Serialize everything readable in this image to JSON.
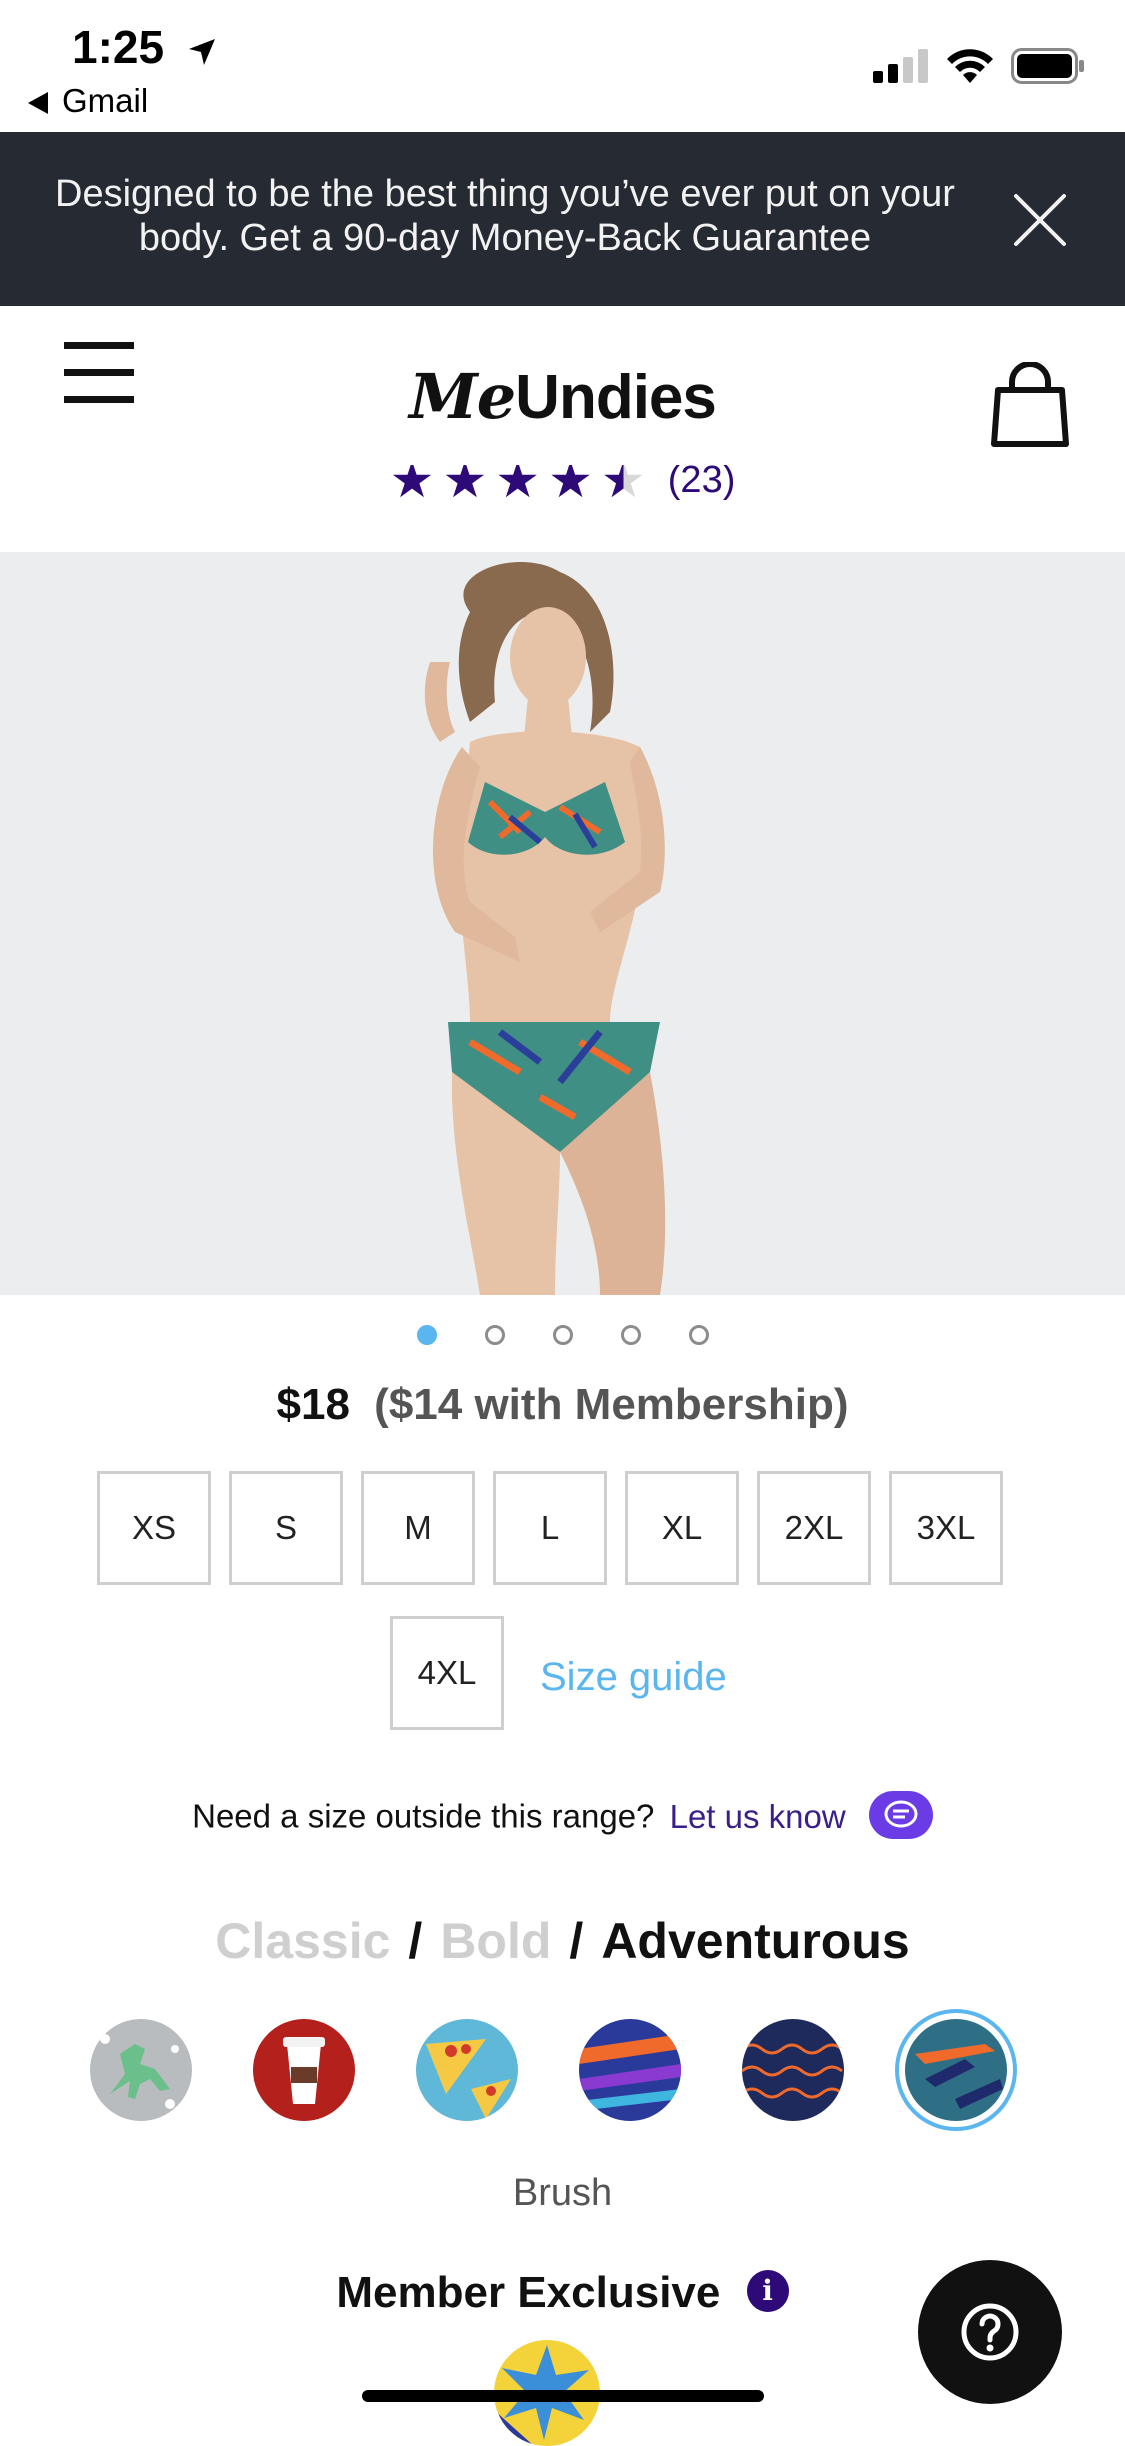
{
  "status_bar": {
    "time": "1:25",
    "back_app": "Gmail"
  },
  "promo": {
    "text": "Designed to be the best thing you’ve ever put on your body. Get a 90-day Money-Back Guarantee"
  },
  "header": {
    "logo_me": "Me",
    "logo_rest": "Undies"
  },
  "rating": {
    "stars": 4.5,
    "count": "(23)",
    "color": "#2d0a78"
  },
  "carousel": {
    "total": 5,
    "active_index": 0,
    "active_color": "#5bb6f0"
  },
  "price": {
    "price": "$18",
    "member_price": "($14 with Membership)"
  },
  "sizes": [
    "XS",
    "S",
    "M",
    "L",
    "XL",
    "2XL",
    "3XL",
    "4XL"
  ],
  "size_guide": "Size guide",
  "need_size": {
    "text": "Need a size outside this range?",
    "link": "Let us know"
  },
  "category": {
    "classic": "Classic",
    "sep1": "/",
    "bold": "Bold",
    "sep2": "/",
    "adventurous": "Adventurous"
  },
  "swatches": [
    {
      "icon": "dinosaur-pattern-icon"
    },
    {
      "icon": "coffee-cup-pattern-icon"
    },
    {
      "icon": "pizza-pattern-icon"
    },
    {
      "icon": "brush-stroke-pattern-icon"
    },
    {
      "icon": "wave-pattern-icon"
    },
    {
      "icon": "brush-pattern-icon",
      "selected": true
    }
  ],
  "pattern_name": "Brush",
  "member_exclusive": {
    "label": "Member Exclusive",
    "info": "i"
  },
  "colors": {
    "banner_bg": "#252a33",
    "accent_blue": "#5bb6f0",
    "accent_purple": "#6b3ce5",
    "rating_purple": "#2d0a78"
  }
}
